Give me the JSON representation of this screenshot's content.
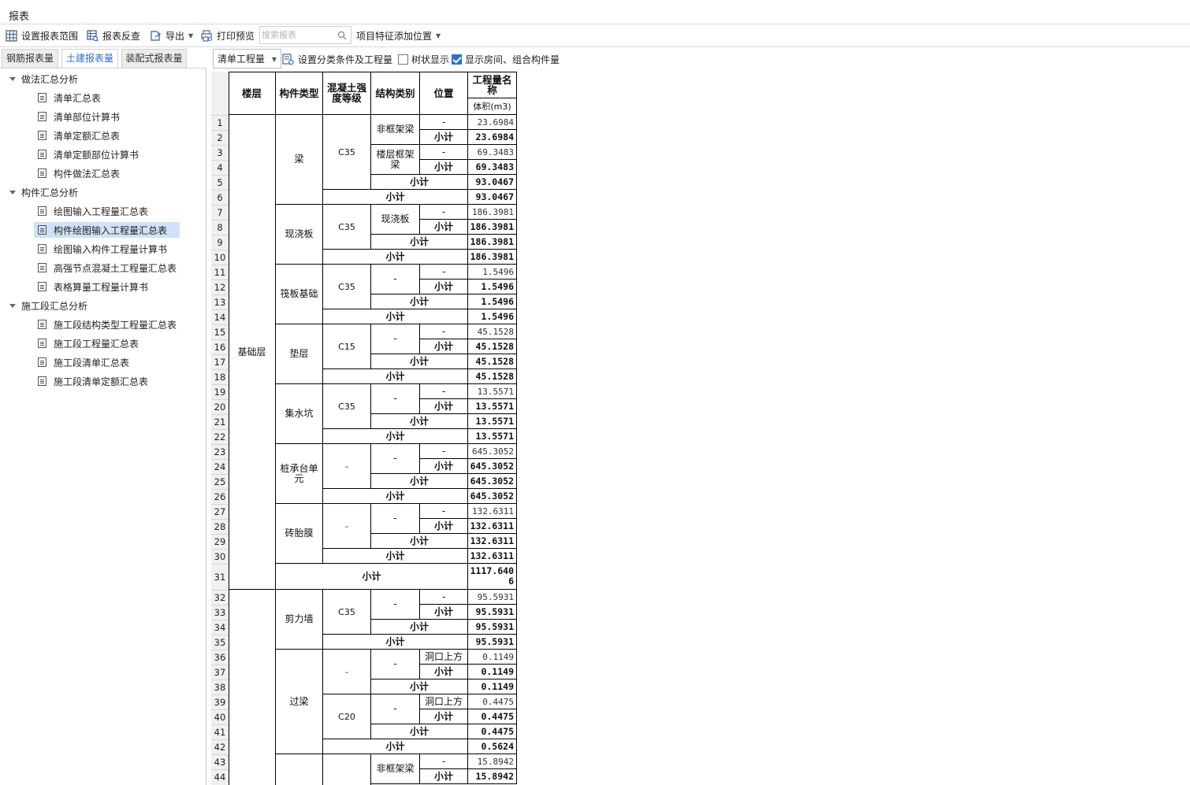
{
  "window": {
    "title": "报表"
  },
  "toolbar": {
    "set_range": "设置报表范围",
    "reverse": "报表反查",
    "export": "导出",
    "print_preview": "打印预览",
    "search_placeholder": "搜索报表",
    "feature_position": "项目特征添加位置"
  },
  "tabs": [
    {
      "label": "钢筋报表量",
      "active": false
    },
    {
      "label": "土建报表量",
      "active": true
    },
    {
      "label": "装配式报表量",
      "active": false
    }
  ],
  "tree": {
    "groups": [
      {
        "label": "做法汇总分析",
        "items": [
          "清单汇总表",
          "清单部位计算书",
          "清单定额汇总表",
          "清单定额部位计算书",
          "构件做法汇总表"
        ]
      },
      {
        "label": "构件汇总分析",
        "items": [
          "绘图输入工程量汇总表",
          "构件绘图输入工程量汇总表",
          "绘图输入构件工程量计算书",
          "高强节点混凝土工程量汇总表",
          "表格算量工程量计算书"
        ]
      },
      {
        "label": "施工段汇总分析",
        "items": [
          "施工段结构类型工程量汇总表",
          "施工段工程量汇总表",
          "施工段清单汇总表",
          "施工段清单定额汇总表"
        ]
      }
    ],
    "selected": "构件绘图输入工程量汇总表"
  },
  "report_toolbar": {
    "quantity_type": "清单工程量",
    "set_conditions": "设置分类条件及工程量",
    "tree_view_label": "树状显示",
    "tree_view_checked": false,
    "show_rooms_label": "显示房间、组合构件量",
    "show_rooms_checked": true
  },
  "report": {
    "headers": {
      "floor": "楼层",
      "component_type": "构件类型",
      "concrete_grade": "混凝土强度等级",
      "structure_type": "结构类别",
      "position": "位置",
      "quantity_name": "工程量名称",
      "volume": "体积(m3)"
    },
    "subtotal_label": "小计",
    "row_numbers": [
      "1",
      "2",
      "3",
      "4",
      "5",
      "6",
      "7",
      "8",
      "9",
      "10",
      "11",
      "12",
      "13",
      "14",
      "15",
      "16",
      "17",
      "18",
      "19",
      "20",
      "21",
      "22",
      "23",
      "24",
      "25",
      "26",
      "27",
      "28",
      "29",
      "30",
      "31",
      "32",
      "33",
      "34",
      "35",
      "36",
      "37",
      "38",
      "39",
      "40",
      "41",
      "42",
      "43",
      "44"
    ],
    "floors": [
      {
        "name": "基础层",
        "subtotal": "1117.6406"
      },
      {
        "name": "",
        "subtotal": ""
      }
    ],
    "components": [
      {
        "name": "梁",
        "grade": "C35",
        "subtotal": "93.0467",
        "structures": [
          {
            "name": "非框架梁",
            "position": "-",
            "value": "23.6984",
            "subtotal": "23.6984"
          },
          {
            "name": "楼层框架梁",
            "position": "-",
            "value": "69.3483",
            "subtotal": "69.3483"
          }
        ],
        "grade_subtotal": "93.0467"
      },
      {
        "name": "现浇板",
        "grade": "C35",
        "subtotal": "186.3981",
        "structures": [
          {
            "name": "现浇板",
            "position": "-",
            "value": "186.3981",
            "subtotal": "186.3981"
          }
        ],
        "grade_subtotal": "186.3981"
      },
      {
        "name": "筏板基础",
        "grade": "C35",
        "subtotal": "1.5496",
        "structures": [
          {
            "name": "-",
            "position": "-",
            "value": "1.5496",
            "subtotal": "1.5496"
          }
        ],
        "grade_subtotal": "1.5496"
      },
      {
        "name": "垫层",
        "grade": "C15",
        "subtotal": "45.1528",
        "structures": [
          {
            "name": "-",
            "position": "-",
            "value": "45.1528",
            "subtotal": "45.1528"
          }
        ],
        "grade_subtotal": "45.1528"
      },
      {
        "name": "集水坑",
        "grade": "C35",
        "subtotal": "13.5571",
        "structures": [
          {
            "name": "-",
            "position": "-",
            "value": "13.5571",
            "subtotal": "13.5571"
          }
        ],
        "grade_subtotal": "13.5571"
      },
      {
        "name": "桩承台单元",
        "grade": "-",
        "subtotal": "645.3052",
        "structures": [
          {
            "name": "-",
            "position": "-",
            "value": "645.3052",
            "subtotal": "645.3052"
          }
        ],
        "grade_subtotal": "645.3052"
      },
      {
        "name": "砖胎膜",
        "grade": "-",
        "subtotal": "132.6311",
        "structures": [
          {
            "name": "-",
            "position": "-",
            "value": "132.6311",
            "subtotal": "132.6311"
          }
        ],
        "grade_subtotal": "132.6311"
      },
      {
        "name": "剪力墙",
        "grade": "C35",
        "subtotal": "95.5931",
        "structures": [
          {
            "name": "-",
            "position": "-",
            "value": "95.5931",
            "subtotal": "95.5931"
          }
        ],
        "grade_subtotal": "95.5931"
      },
      {
        "name": "过梁",
        "subtotal": "0.5624",
        "grades": [
          {
            "grade": "-",
            "structure": "-",
            "position": "洞口上方",
            "value": "0.1149",
            "subtotal": "0.1149",
            "grade_subtotal": "0.1149"
          },
          {
            "grade": "C20",
            "structure": "-",
            "position": "洞口上方",
            "value": "0.4475",
            "subtotal": "0.4475",
            "grade_subtotal": "0.4475"
          }
        ]
      },
      {
        "name": "",
        "grade": "",
        "structures": [
          {
            "name": "非框架梁",
            "position": "-",
            "value": "15.8942",
            "subtotal": "15.8942"
          }
        ]
      }
    ]
  }
}
